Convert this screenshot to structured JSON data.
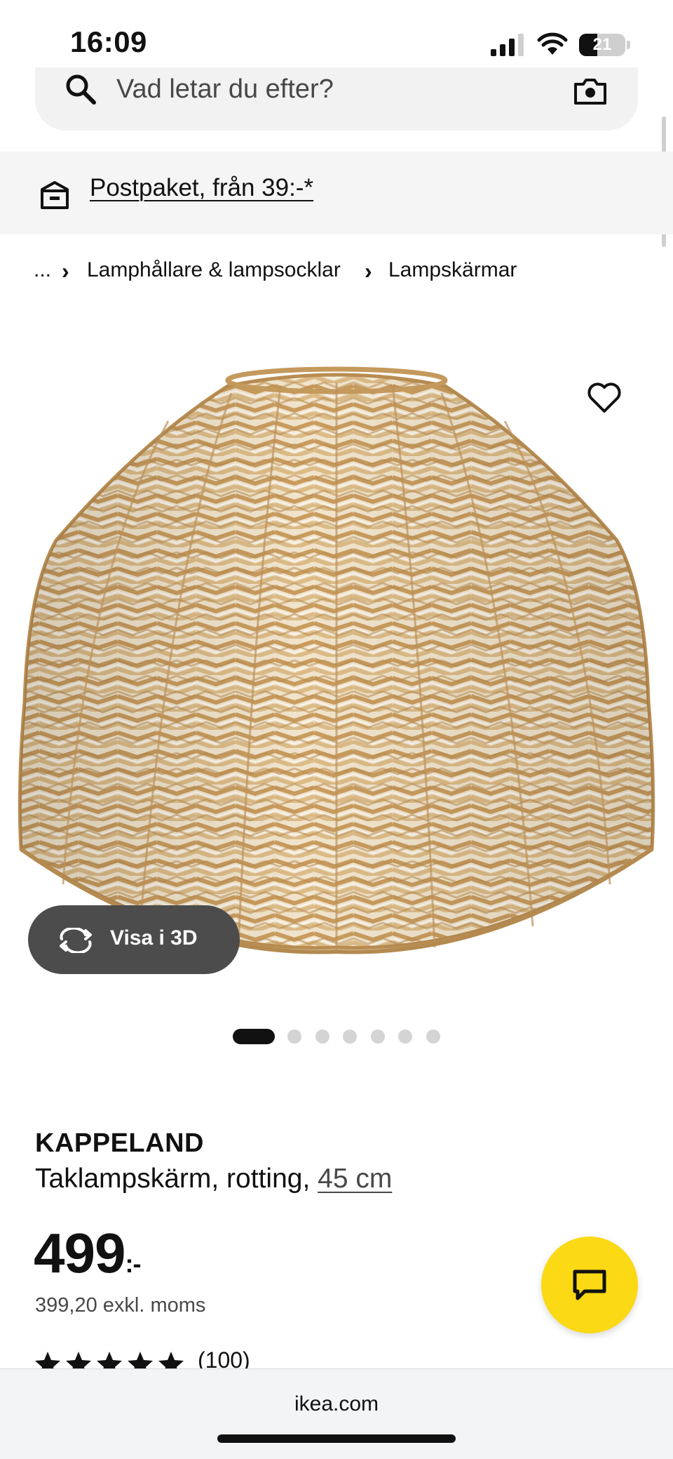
{
  "status_bar": {
    "time": "16:09",
    "battery": "21",
    "signal_icon": "signal-bars-icon",
    "wifi_icon": "wifi-icon"
  },
  "search": {
    "placeholder": "Vad letar du efter?",
    "search_icon": "search-icon",
    "camera_icon": "camera-icon"
  },
  "banner": {
    "icon": "package-icon",
    "text": "Postpaket, från 39:-*"
  },
  "breadcrumb": {
    "ellipsis": "...",
    "items": [
      "Lamphållare & lampsocklar",
      "Lampskärmar"
    ]
  },
  "product_image": {
    "favorite_icon": "heart-icon",
    "view_3d_label": "Visa i 3D",
    "view_3d_icon": "rotate-icon",
    "carousel_count": 7,
    "carousel_active": 1
  },
  "product": {
    "name": "KAPPELAND",
    "description": "Taklampskärm, rotting,",
    "size": "45 cm",
    "price": "499",
    "price_suffix": ":-",
    "price_excl_vat": "399,20 exkl. moms",
    "rating_stars": 5,
    "rating_count": "(100)"
  },
  "chat": {
    "icon": "chat-bubble-icon"
  },
  "browser": {
    "url": "ikea.com"
  },
  "colors": {
    "accent_yellow": "#fbd914",
    "text": "#111111",
    "muted": "#484848",
    "dark_pill": "#4c4c4c",
    "wicker_light": "#e2c69a",
    "wicker_dark": "#b98d52"
  }
}
